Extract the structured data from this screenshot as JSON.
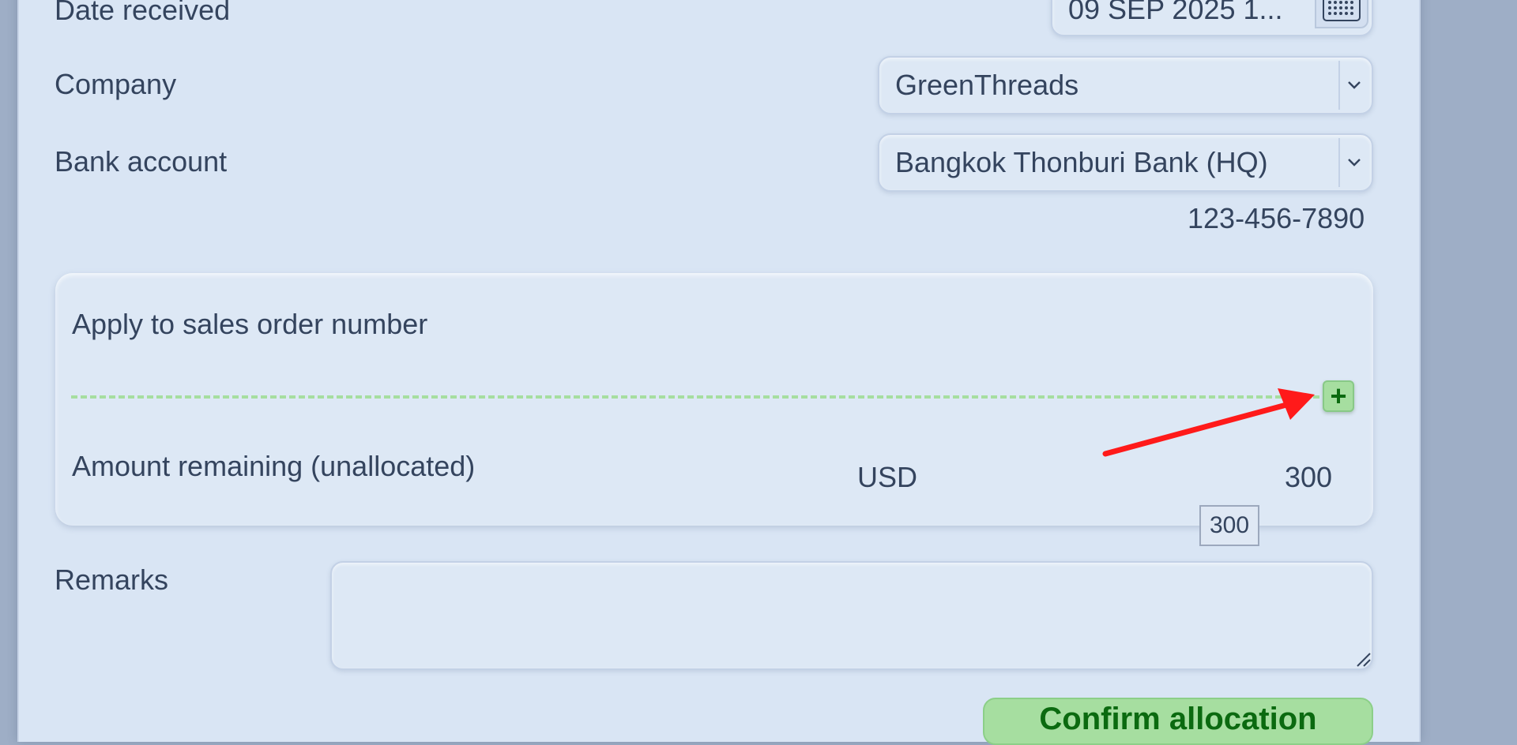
{
  "form": {
    "date_received_label": "Date received",
    "date_received_value": "09 SEP 2025 1...",
    "company_label": "Company",
    "company_value": "GreenThreads",
    "bank_account_label": "Bank account",
    "bank_account_value": "Bangkok Thonburi Bank (HQ)",
    "bank_account_number": "123-456-7890",
    "remarks_label": "Remarks",
    "remarks_value": "",
    "confirm_label": "Confirm allocation"
  },
  "allocation": {
    "apply_label": "Apply to sales order number",
    "add_icon": "plus-icon",
    "amount_remaining_label": "Amount remaining (unallocated)",
    "currency": "USD",
    "amount": "300",
    "tooltip_value": "300"
  },
  "colors": {
    "accent_green": "#a6dea0",
    "accent_green_text": "#0b6a10",
    "annotation_arrow": "#ff1a1a"
  }
}
